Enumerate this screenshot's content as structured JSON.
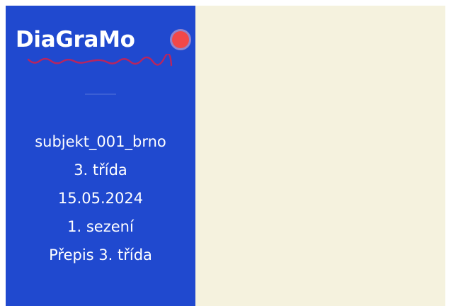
{
  "sidebar": {
    "logo": {
      "text": "DiaGraMo",
      "dot_color": "#f24848",
      "wave_color": "#b8255f"
    },
    "info": {
      "subject": "subjekt_001_brno",
      "class": "3. třída",
      "date": "15.05.2024",
      "session": "1. sezení",
      "transcript": "Přepis 3. třída"
    },
    "background_color": "#2049cf"
  },
  "main": {
    "background_color": "#f5f2de"
  }
}
